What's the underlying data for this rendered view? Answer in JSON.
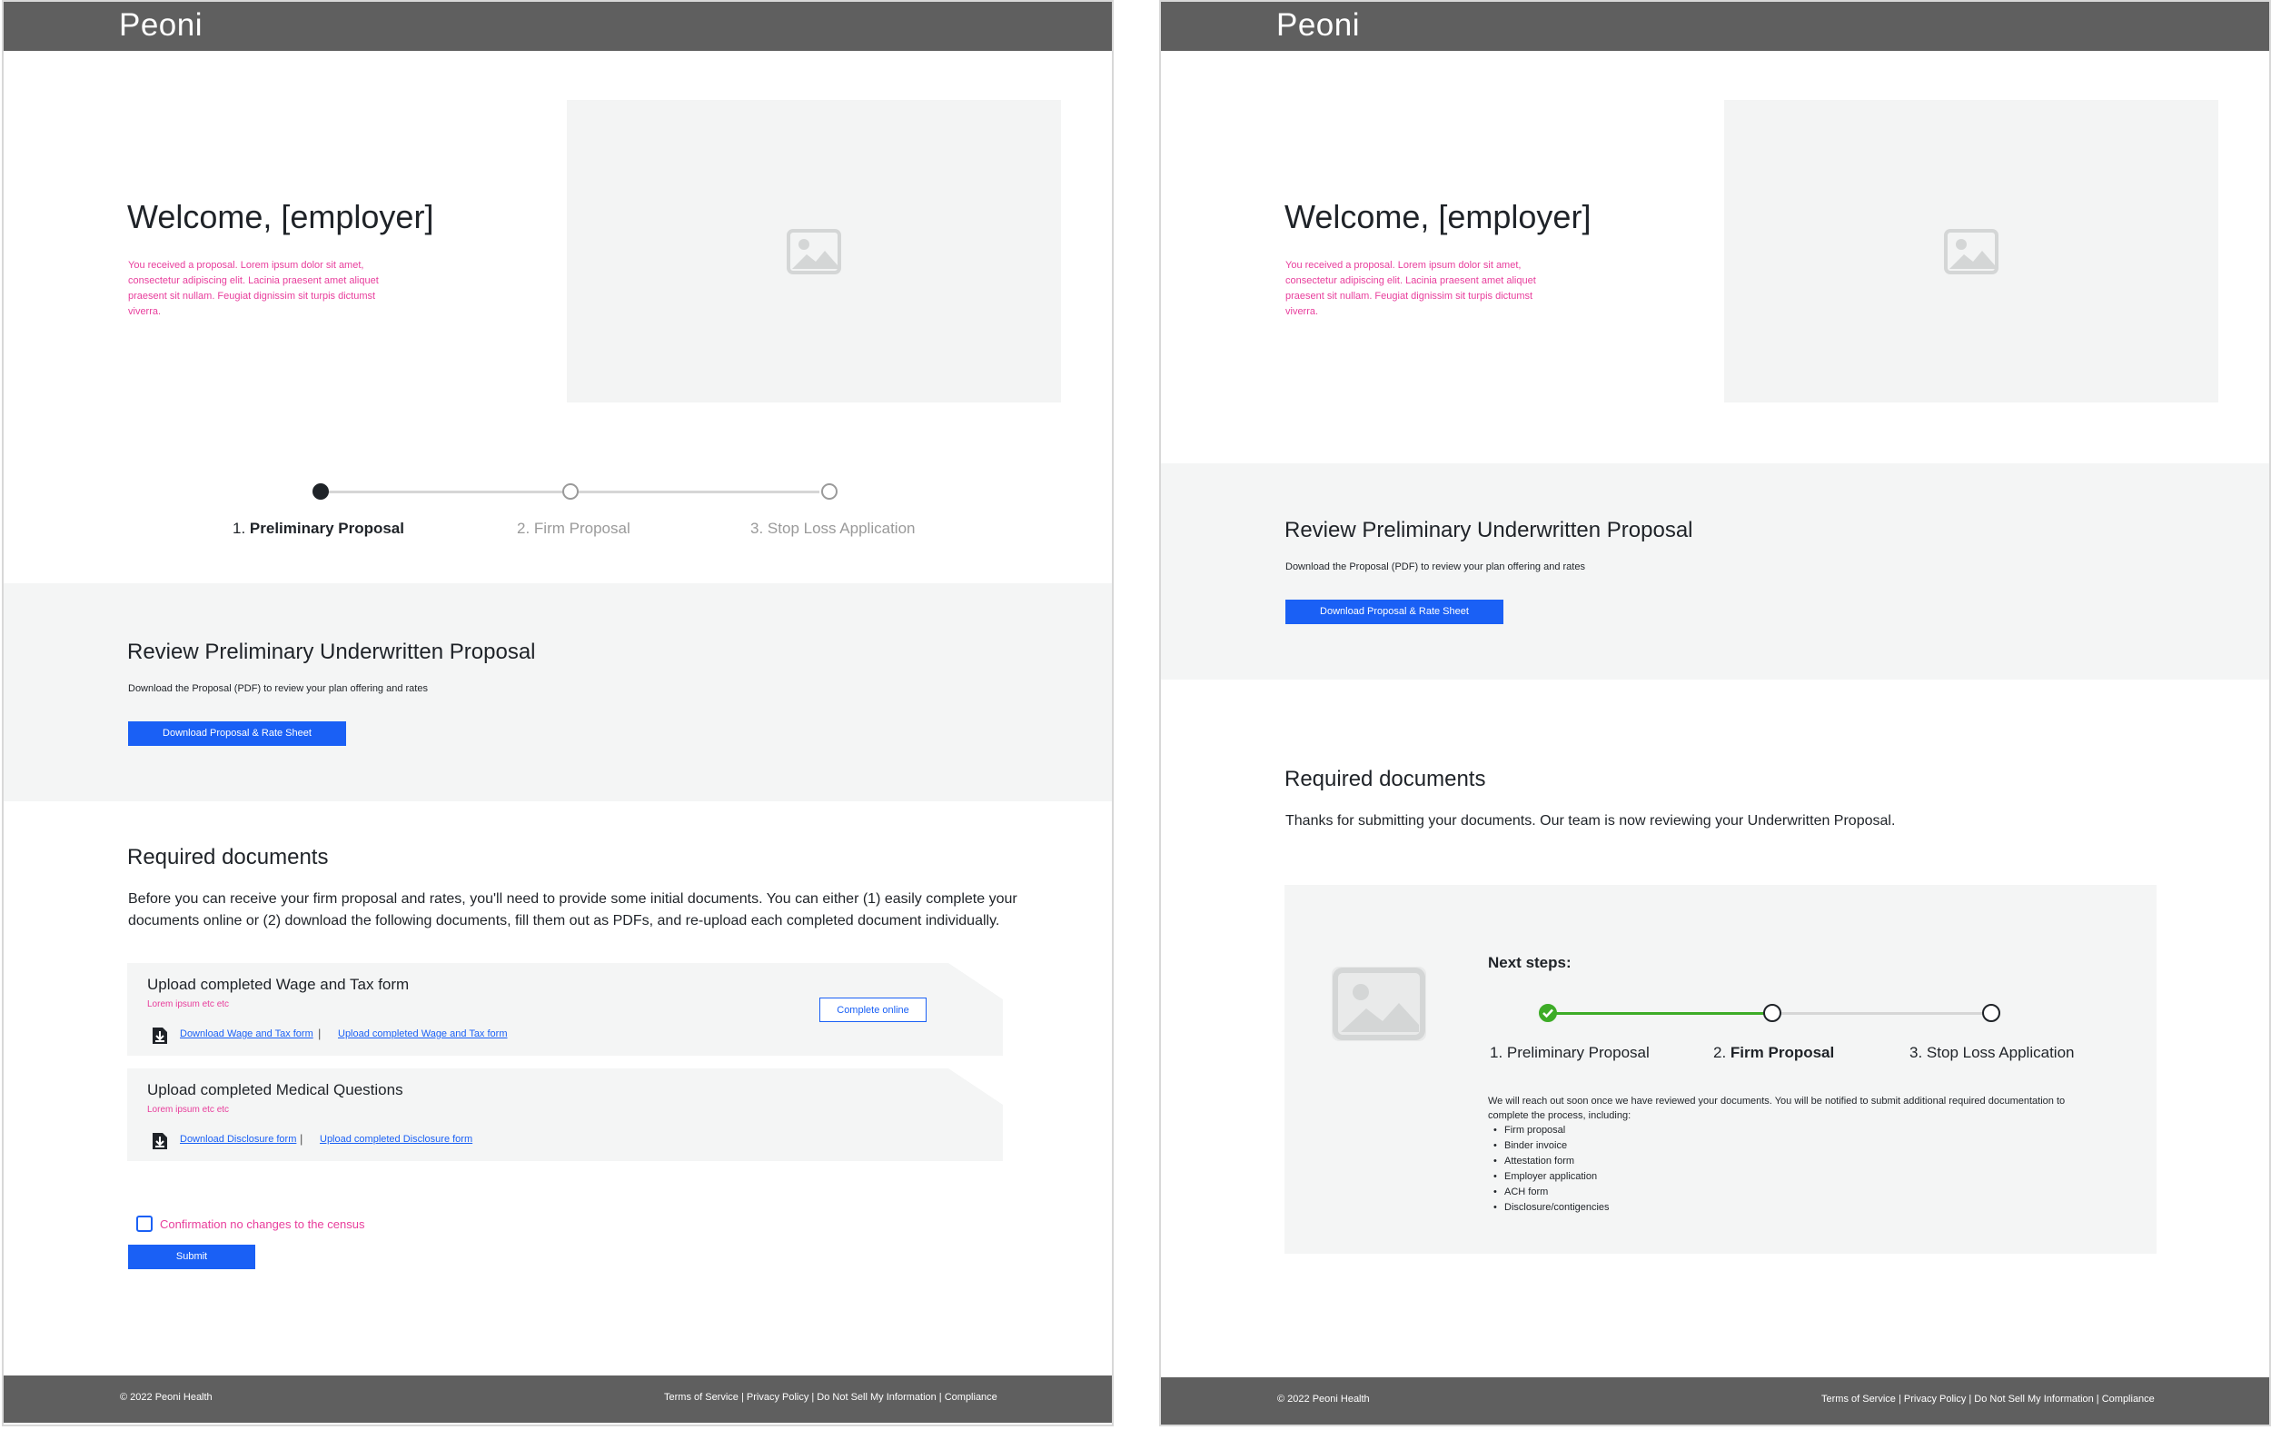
{
  "brand": "Peoni",
  "colors": {
    "accent": "#1a60f5",
    "pink": "#e83e9c",
    "header": "#5f5f5f",
    "band": "#f4f5f5",
    "success": "#3dac27"
  },
  "hero": {
    "title": "Welcome, [employer]",
    "text": "You received a proposal. Lorem ipsum dolor sit amet, consectetur adipiscing elit. Lacinia praesent amet aliquet praesent sit nullam. Feugiat dignissim sit turpis dictumst viverra.",
    "image_icon": "image-placeholder-icon"
  },
  "stepper": {
    "steps": [
      {
        "num": "1.",
        "label": "Preliminary Proposal"
      },
      {
        "num": "2.",
        "label": "Firm Proposal"
      },
      {
        "num": "3.",
        "label": "Stop Loss Application"
      }
    ]
  },
  "review": {
    "title": "Review Preliminary Underwritten Proposal",
    "text": "Download the Proposal (PDF) to review your plan offering and rates",
    "button": "Download Proposal & Rate Sheet"
  },
  "required": {
    "title": "Required documents",
    "intro": "Before you can receive your firm proposal and rates, you'll need to provide some initial documents. You can either (1) easily complete your documents online or (2) download the following documents, fill them out as PDFs, and re-upload each completed document individually.",
    "cards": [
      {
        "title": "Upload completed Wage and Tax form",
        "subtitle": "Lorem ipsum etc etc",
        "download_link": "Download Wage and Tax form",
        "upload_link": "Upload completed Wage and Tax form",
        "action_button": "Complete online"
      },
      {
        "title": "Upload completed Medical Questions",
        "subtitle": "Lorem ipsum etc etc",
        "download_link": "Download Disclosure form",
        "upload_link": "Upload completed Disclosure form"
      }
    ],
    "separator": "|",
    "confirmation": "Confirmation no changes to the census",
    "submit": "Submit",
    "thanks": "Thanks for submitting your documents. Our team is now reviewing your Underwritten Proposal."
  },
  "next_steps": {
    "title": "Next steps:",
    "description": "We will reach out soon once we have reviewed your documents. You will be notified to submit additional required documentation to complete the process, including:",
    "items": [
      "Firm proposal",
      "Binder invoice",
      "Attestation form",
      "Employer application",
      "ACH form",
      "Disclosure/contigencies"
    ]
  },
  "footer": {
    "copyright": "© 2022 Peoni Health",
    "links": [
      "Terms of Service",
      "Privacy Policy",
      "Do Not Sell My Information",
      "Compliance"
    ],
    "links_text": "Terms of Service | Privacy Policy |  Do Not Sell My Information | Compliance"
  }
}
